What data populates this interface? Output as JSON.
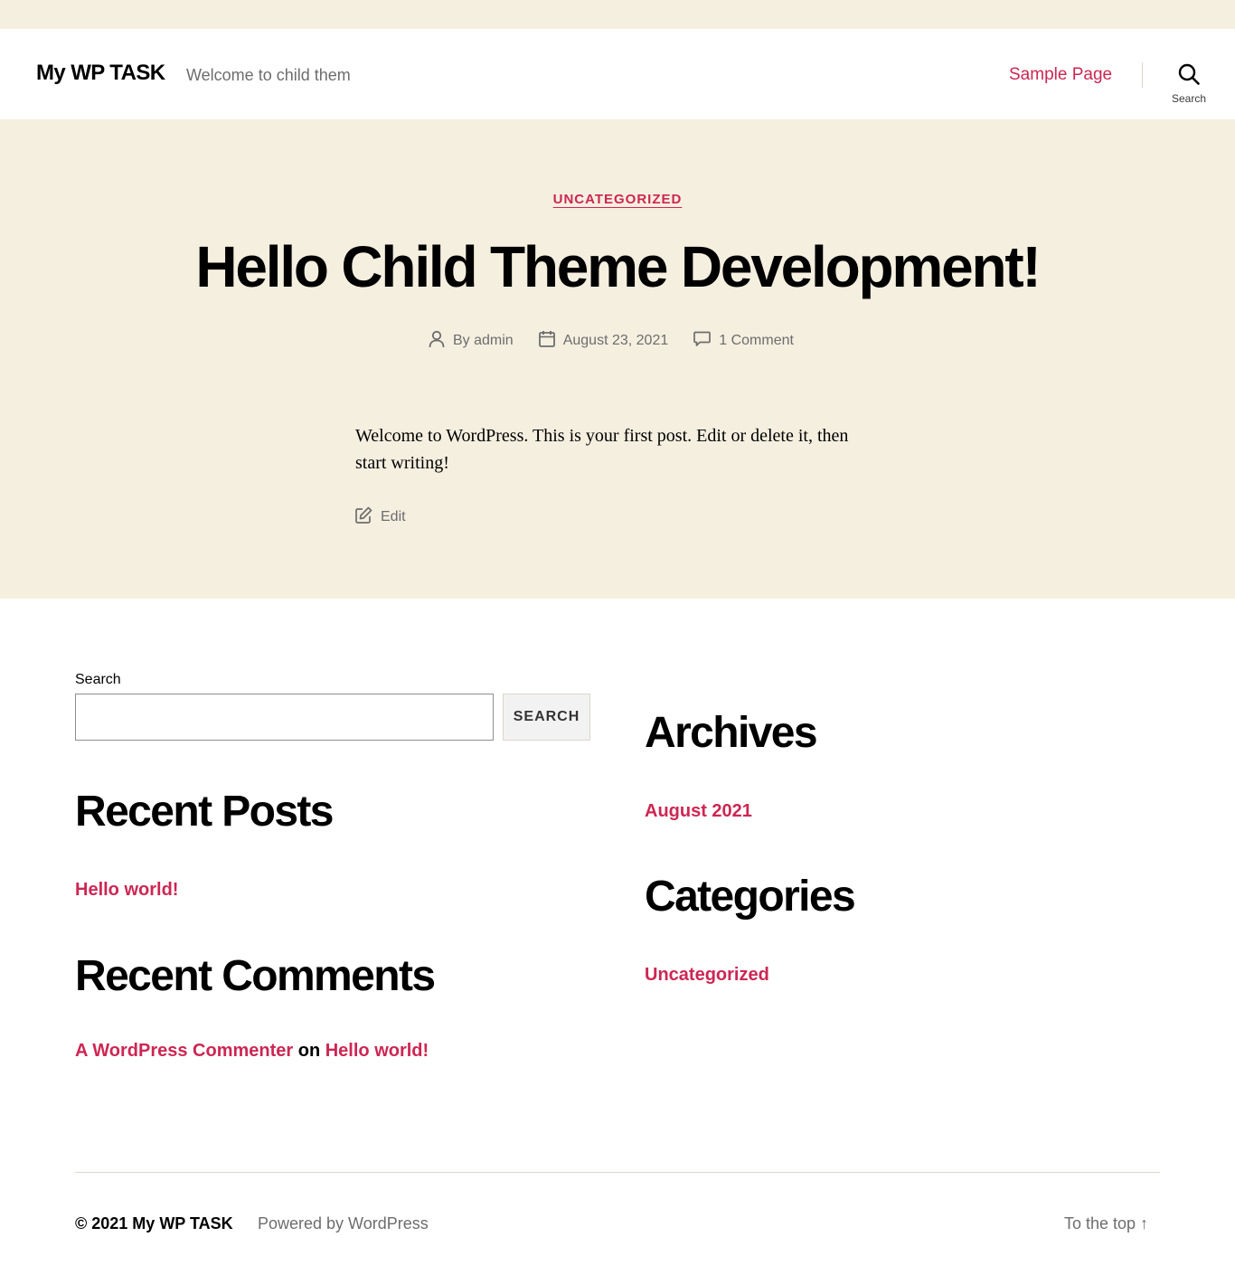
{
  "header": {
    "site_title": "My WP TASK",
    "site_description": "Welcome to child them",
    "nav": [
      {
        "label": "Sample Page"
      }
    ],
    "search_toggle_label": "Search"
  },
  "post": {
    "category": "UNCATEGORIZED",
    "title": "Hello Child Theme Development!",
    "author": "By admin",
    "date": "August 23, 2021",
    "comments": "1 Comment",
    "content": "Welcome to WordPress. This is your first post. Edit or delete it, then start writing!",
    "edit_label": "Edit"
  },
  "widgets": {
    "search": {
      "label": "Search",
      "value": "",
      "button_label": "SEARCH"
    },
    "recent_posts": {
      "title": "Recent Posts",
      "items": [
        {
          "label": "Hello world!"
        }
      ]
    },
    "recent_comments": {
      "title": "Recent Comments",
      "items": [
        {
          "author": "A WordPress Commenter",
          "on": "on",
          "post": "Hello world!"
        }
      ]
    },
    "archives": {
      "title": "Archives",
      "items": [
        {
          "label": "August 2021"
        }
      ]
    },
    "categories": {
      "title": "Categories",
      "items": [
        {
          "label": "Uncategorized"
        }
      ]
    }
  },
  "footer": {
    "copyright": "© 2021 My WP TASK",
    "powered_by": "Powered by WordPress",
    "to_top": "To the top ↑"
  },
  "colors": {
    "accent": "#cd2653",
    "background_tint": "#f5efe0",
    "secondary_text": "#6d6d6d"
  },
  "icons": [
    "search-icon",
    "person-icon",
    "calendar-icon",
    "comment-icon",
    "edit-icon"
  ]
}
